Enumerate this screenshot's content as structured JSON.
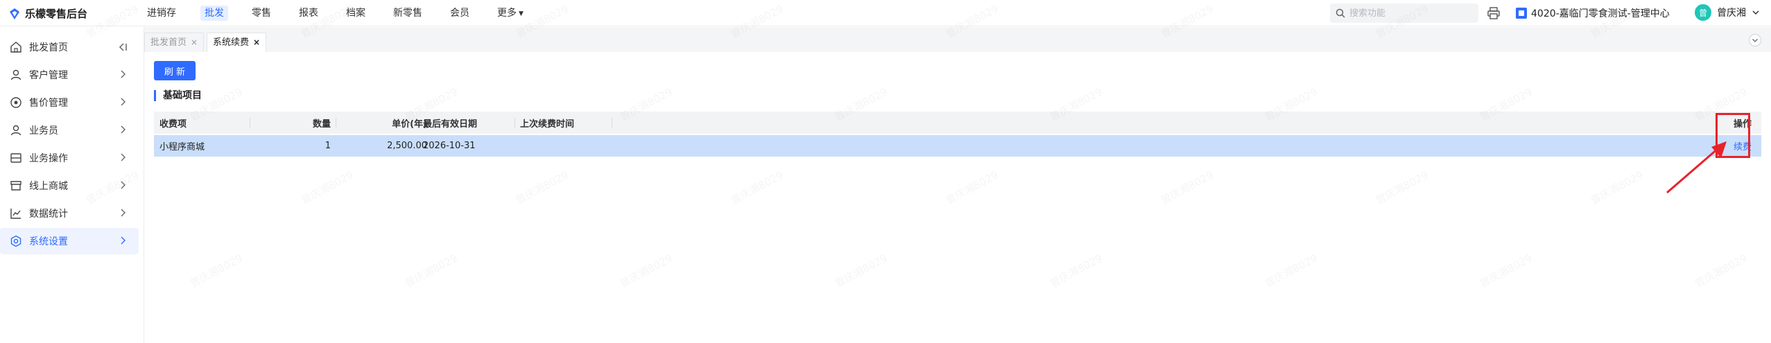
{
  "app": {
    "title": "乐檬零售后台"
  },
  "topnav": {
    "items": [
      {
        "label": "进销存",
        "active": false
      },
      {
        "label": "批发",
        "active": true
      },
      {
        "label": "零售",
        "active": false
      },
      {
        "label": "报表",
        "active": false
      },
      {
        "label": "档案",
        "active": false
      },
      {
        "label": "新零售",
        "active": false
      },
      {
        "label": "会员",
        "active": false
      },
      {
        "label": "更多",
        "active": false
      }
    ],
    "search_placeholder": "搜索功能",
    "store_name": "4020-嘉临门零食测试-管理中心",
    "user_name": "曾庆湘",
    "avatar_text": "曾"
  },
  "sidebar": {
    "items": [
      {
        "label": "批发首页",
        "icon": "home-icon"
      },
      {
        "label": "客户管理",
        "icon": "person-icon"
      },
      {
        "label": "售价管理",
        "icon": "price-icon"
      },
      {
        "label": "业务员",
        "icon": "person-icon"
      },
      {
        "label": "业务操作",
        "icon": "box-icon"
      },
      {
        "label": "线上商城",
        "icon": "shop-icon"
      },
      {
        "label": "数据统计",
        "icon": "chart-icon"
      },
      {
        "label": "系统设置",
        "icon": "settings-icon",
        "active": true
      }
    ]
  },
  "tabs": [
    {
      "label": "批发首页",
      "close": "×",
      "active": false
    },
    {
      "label": "系统续费",
      "close": "×",
      "active": true
    }
  ],
  "main": {
    "refresh_label": "刷 新",
    "section_title": "基础项目",
    "table": {
      "headers": [
        "收费项",
        "数量",
        "单价(年)",
        "最后有效日期",
        "上次续费时间",
        "操作"
      ],
      "rows": [
        {
          "item": "小程序商城",
          "qty": "1",
          "price": "2,500.00",
          "expiry": "2026-10-31",
          "last": "",
          "action": "续费"
        }
      ]
    }
  },
  "watermark_text": "曾庆湘8029",
  "colors": {
    "accent": "#2f6bff",
    "selected_row": "#c9defb",
    "annotation": "#e8222b"
  }
}
